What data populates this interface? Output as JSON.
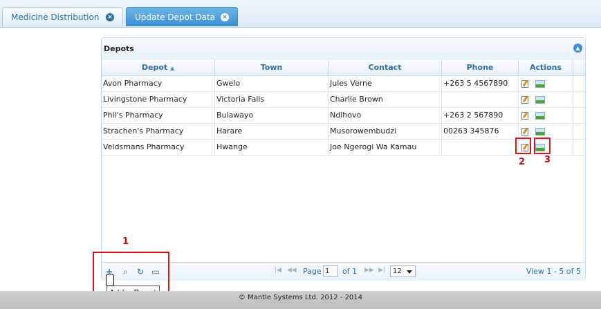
{
  "tabs": [
    {
      "label": "Medicine Distribution",
      "close": "×"
    },
    {
      "label": "Update Depot Data",
      "close": "×"
    }
  ],
  "grid": {
    "caption": "Depots",
    "collapse_icon": "chevron-up-icon",
    "columns": [
      "Depot",
      "Town",
      "Contact",
      "Phone",
      "Actions"
    ],
    "sort_indicator": "▲",
    "rows": [
      {
        "depot": "Avon Pharmacy",
        "town": "Gwelo",
        "contact": "Jules Verne",
        "phone": "+263 5 4567890"
      },
      {
        "depot": "Livingstone Pharmacy",
        "town": "Victoria Falls",
        "contact": "Charlie Brown",
        "phone": ""
      },
      {
        "depot": "Phil's Pharmacy",
        "town": "Bulawayo",
        "contact": "Ndlhovo",
        "phone": "+263 2 567890"
      },
      {
        "depot": "Strachen's Pharmacy",
        "town": "Harare",
        "contact": "Musorowembudzi",
        "phone": "00263 345876"
      },
      {
        "depot": "Veldsmans Pharmacy",
        "town": "Hwange",
        "contact": "Joe Ngerogi Wa Kamau",
        "phone": ""
      }
    ]
  },
  "pager": {
    "add_icon": "+",
    "search_icon": "⌕",
    "refresh_icon": "↻",
    "columns_icon": "▭",
    "first": "|◀",
    "prev": "◀◀",
    "page_label": "Page",
    "page_value": "1",
    "of_label": "of 1",
    "next": "▶▶",
    "last": "▶|",
    "rows_per_page": "12",
    "view_text": "View 1 - 5 of 5"
  },
  "tooltip": "Add a Depot",
  "annotations": [
    "1",
    "2",
    "3"
  ],
  "footer": "© Mantle Systems Ltd. 2012 - 2014"
}
